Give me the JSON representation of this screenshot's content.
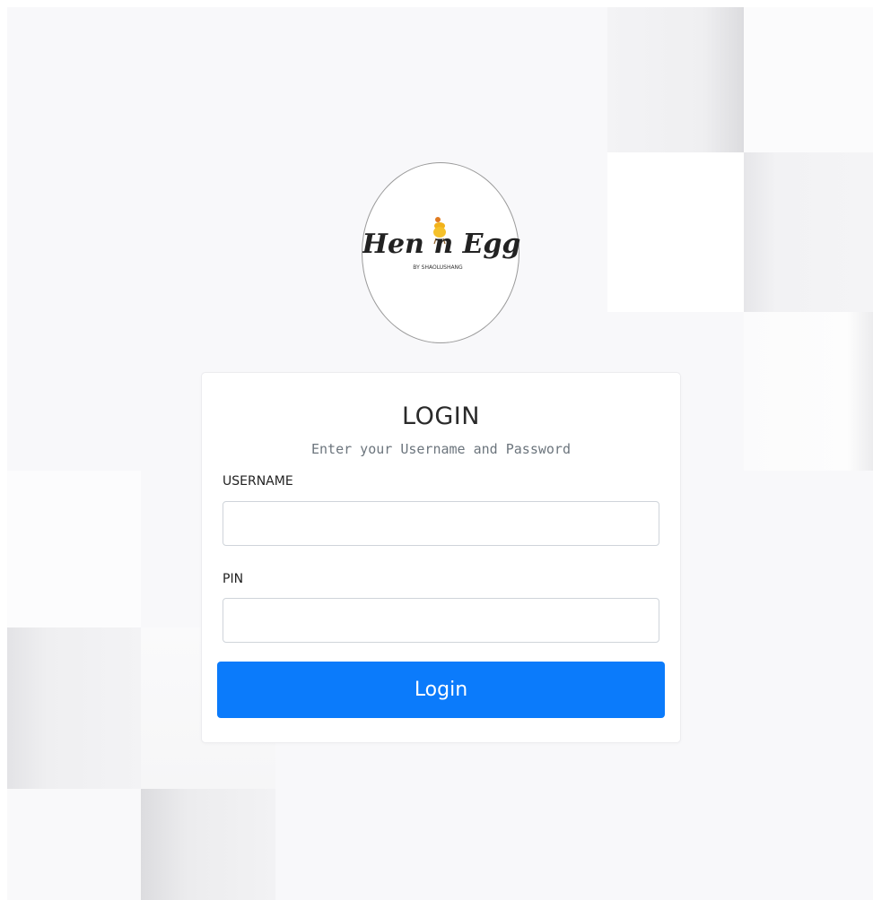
{
  "logo": {
    "name": "Hen n Egg",
    "tagline": "BY SHAOLUSHANG"
  },
  "login": {
    "title": "LOGIN",
    "subtitle": "Enter your Username and Password",
    "username_label": "USERNAME",
    "username_value": "",
    "pin_label": "PIN",
    "pin_value": "",
    "button_label": "Login"
  },
  "colors": {
    "accent": "#0b7bfb",
    "background": "#f8f8fa",
    "card": "#ffffff"
  }
}
